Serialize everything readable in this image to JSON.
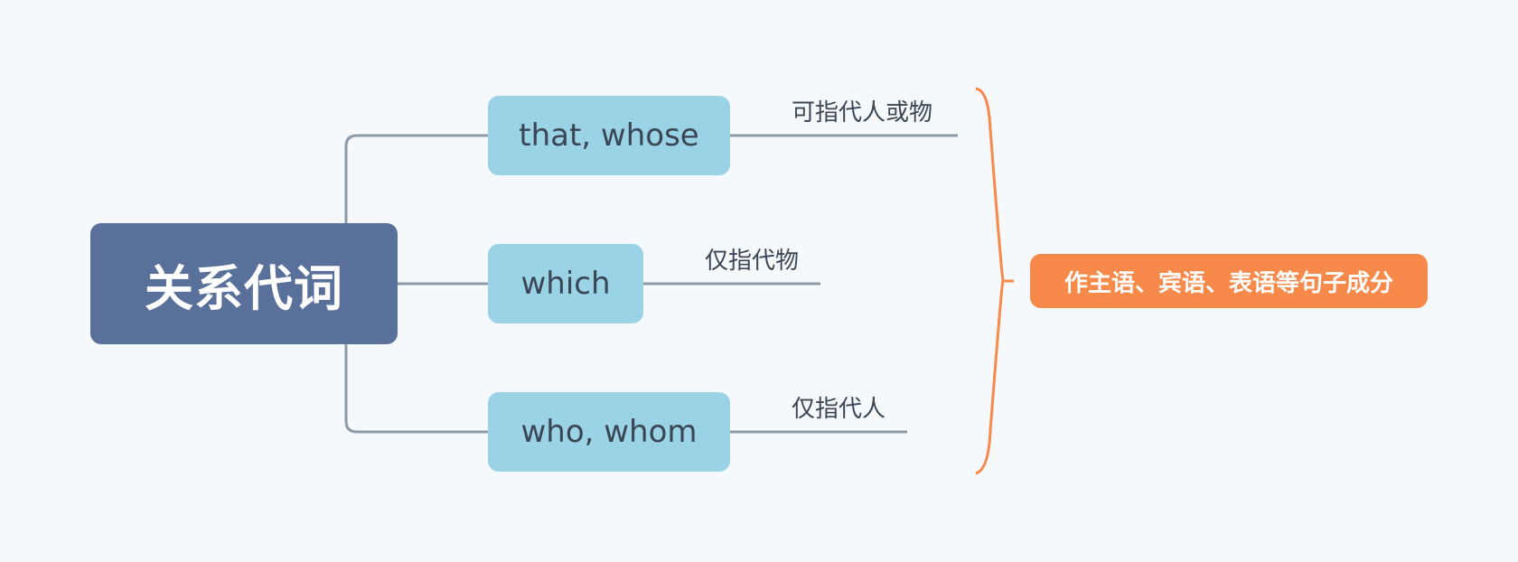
{
  "root": {
    "label": "关系代词"
  },
  "children": [
    {
      "label": "that, whose",
      "note": "可指代人或物"
    },
    {
      "label": "which",
      "note": "仅指代物"
    },
    {
      "label": "who, whom",
      "note": "仅指代人"
    }
  ],
  "summary": {
    "label": "作主语、宾语、表语等句子成分"
  },
  "colors": {
    "background": "#f5f9fc",
    "root_fill": "#58709a",
    "child_fill": "#9ad2e6",
    "connector": "#8d99a6",
    "summary_fill": "#f7894a",
    "brace": "#f7894a"
  }
}
